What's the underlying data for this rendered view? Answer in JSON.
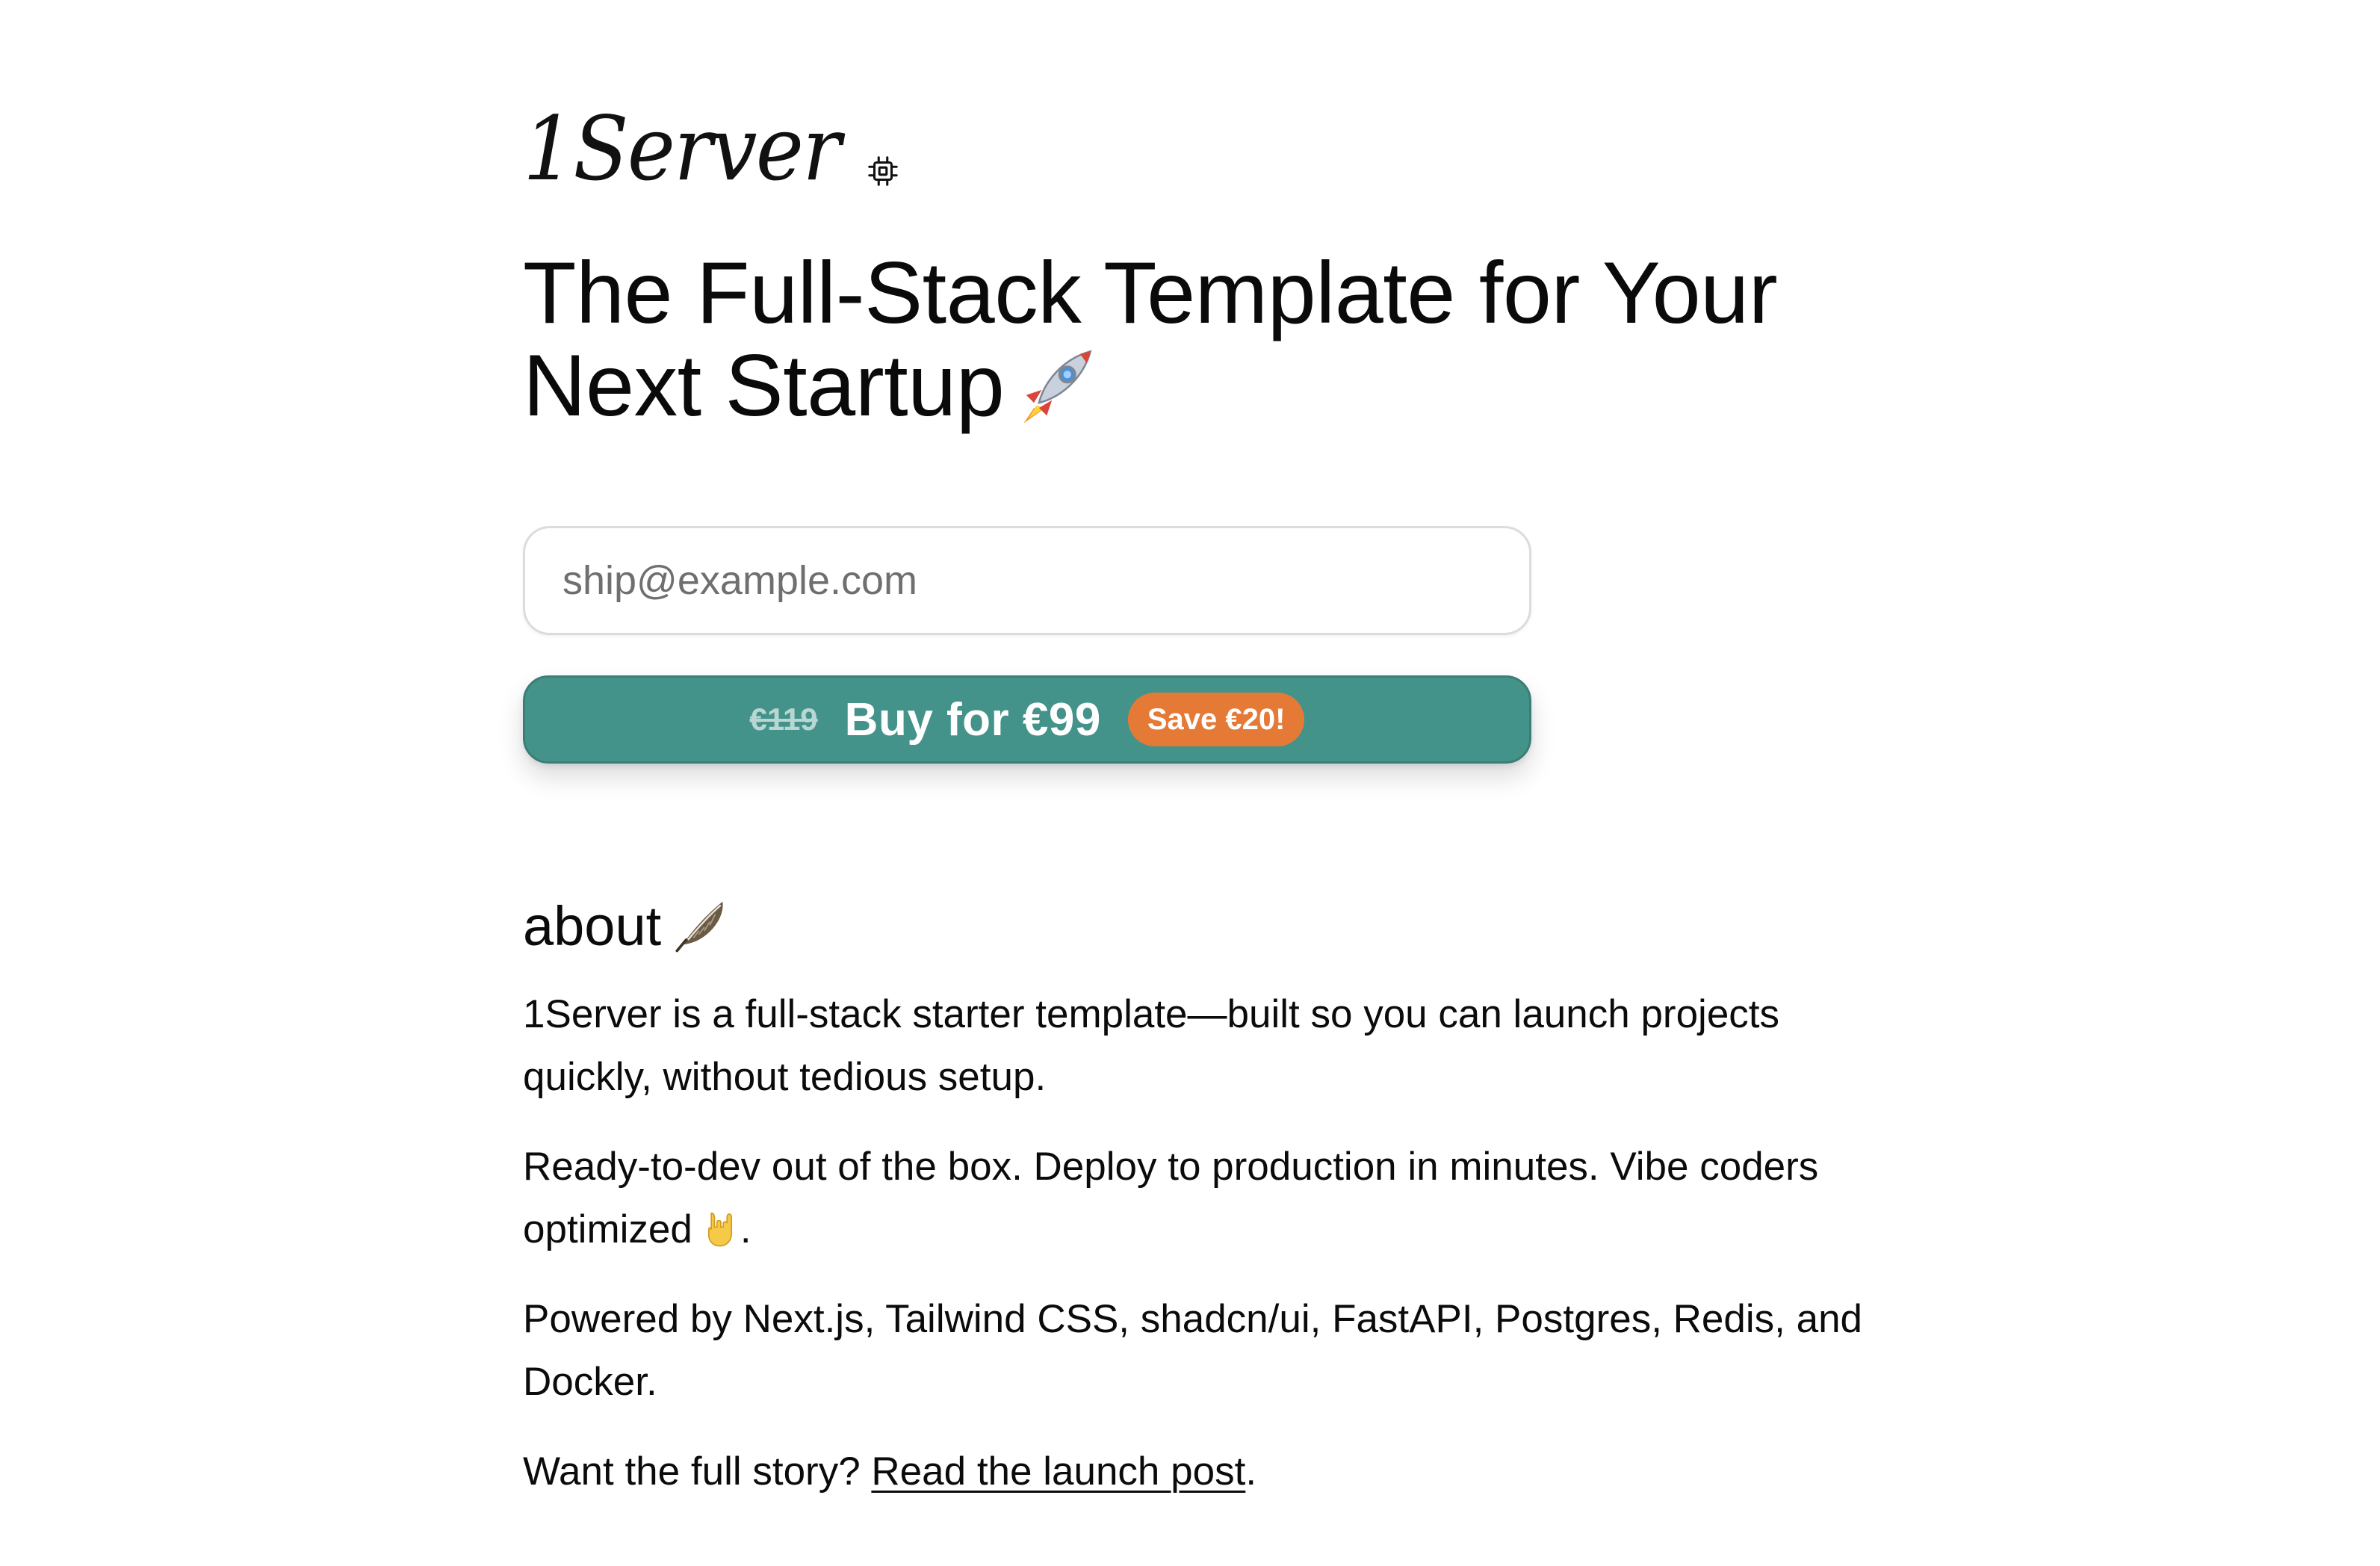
{
  "logo": {
    "text": "1Server",
    "icon": "chip-icon"
  },
  "hero": {
    "headline_line1": "The Full-Stack Template for Your",
    "headline_line2": "Next Startup",
    "headline_icon": "rocket-icon"
  },
  "signup": {
    "email_placeholder": "ship@example.com",
    "email_value": ""
  },
  "buy": {
    "old_price": "€119",
    "label": "Buy for €99",
    "badge": "Save €20!",
    "button_color": "#44938a",
    "badge_color": "#e57a37"
  },
  "about": {
    "heading": "about",
    "heading_icon": "feather-icon",
    "p1": "1Server is a full-stack starter template—built so you can launch projects quickly, without tedious setup.",
    "p2_text": "Ready-to-dev out of the box. Deploy to production in minutes. Vibe coders optimized",
    "p2_icon": "rock-on-hand-icon",
    "p2_end": ".",
    "p3": "Powered by Next.js, Tailwind CSS, shadcn/ui, FastAPI, Postgres, Redis, and Docker.",
    "p4_prefix": "Want the full story? ",
    "p4_link": "Read the launch post",
    "p4_end": "."
  }
}
